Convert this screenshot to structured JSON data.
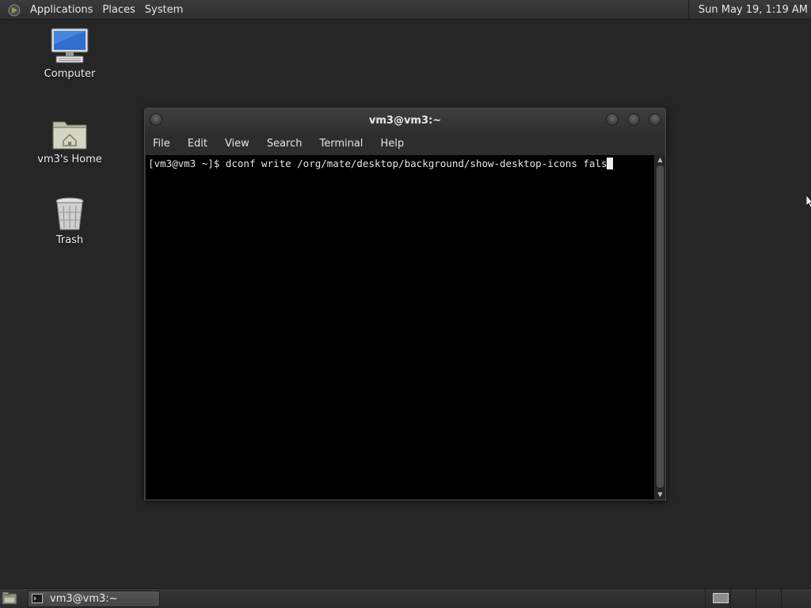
{
  "top_panel": {
    "menus": [
      "Applications",
      "Places",
      "System"
    ],
    "clock": "Sun May 19,  1:19 AM"
  },
  "desktop": {
    "icons": [
      {
        "label": "Computer",
        "icon": "computer-icon"
      },
      {
        "label": "vm3's Home",
        "icon": "home-folder-icon"
      },
      {
        "label": "Trash",
        "icon": "trash-icon"
      }
    ]
  },
  "terminal_window": {
    "title": "vm3@vm3:~",
    "menus": [
      "File",
      "Edit",
      "View",
      "Search",
      "Terminal",
      "Help"
    ],
    "prompt": "[vm3@vm3 ~]$ ",
    "command": "dconf write /org/mate/desktop/background/show-desktop-icons fals"
  },
  "taskbar": {
    "task_label": "vm3@vm3:~",
    "workspace_count": 4,
    "active_workspace": 1
  },
  "colors": {
    "desktop_bg": "#262626",
    "panel_bg": "#333333",
    "terminal_bg": "#000000",
    "terminal_fg": "#e6e6e6"
  }
}
